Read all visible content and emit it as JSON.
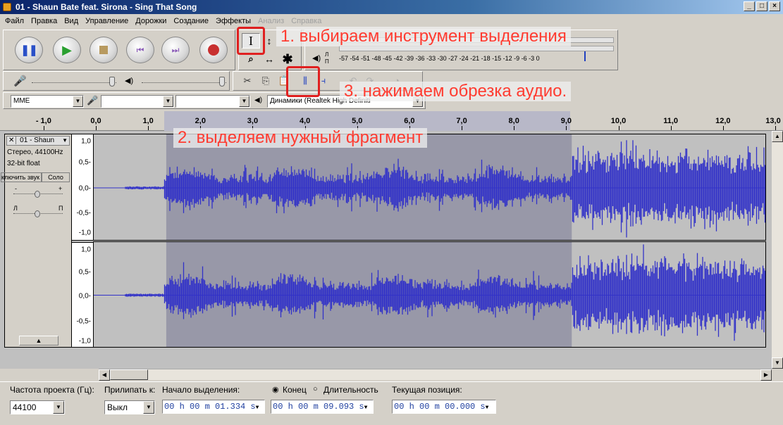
{
  "window": {
    "title": "01 - Shaun Bate feat. Sirona - Sing That Song",
    "controls": [
      "_",
      "□",
      "×"
    ]
  },
  "menu": [
    "Файл",
    "Правка",
    "Вид",
    "Управление",
    "Дорожки",
    "Создание",
    "Эффекты",
    "Анализ",
    "Справка"
  ],
  "transport": {
    "icons": [
      "pause-icon",
      "play-icon",
      "stop-icon",
      "skip-start-icon",
      "skip-end-icon",
      "record-icon"
    ]
  },
  "tools": {
    "selection_tool": "I",
    "envelope_tool": "↕",
    "zoom_tool": "🔍",
    "timeshift_tool": "↔",
    "multi_tool": "✱",
    "active": "selection_tool"
  },
  "meter": {
    "scale": "-57 -54 -51 -48 -45 -42 -39 -36 -33 -30 -27 -24 -21 -18 -15 -12 -9 -6 -3 0",
    "labels": [
      "Л",
      "П"
    ]
  },
  "device": {
    "host": "MME",
    "input": "",
    "channels": "",
    "output": "Динамики (Realtek High Definiti"
  },
  "ruler": {
    "labels": [
      "- 1,0",
      "0,0",
      "1,0",
      "2,0",
      "3,0",
      "4,0",
      "5,0",
      "6,0",
      "7,0",
      "8,0",
      "9,0",
      "10,0",
      "11,0",
      "12,0",
      "13,0"
    ],
    "selection_start": 1.334,
    "selection_end": 9.093
  },
  "track": {
    "name": "01 - Shaun",
    "format": "Стерео, 44100Hz",
    "bit": "32-bit float",
    "mute_label": "ключить звук",
    "solo_label": "Соло",
    "gain_min": "-",
    "gain_max": "+",
    "pan_left": "Л",
    "pan_right": "П",
    "scale_top": [
      "1,0",
      "0,5-",
      "0,0-",
      "-0,5-",
      "-1,0"
    ],
    "scale_bottom": [
      "1,0",
      "0,5-",
      "0,0-",
      "-0,5-",
      "-1,0"
    ]
  },
  "selection_bar": {
    "rate_label": "Частота проекта (Гц):",
    "rate_value": "44100",
    "snap_label": "Прилипать к:",
    "snap_value": "Выкл",
    "start_label": "Начало выделения:",
    "end_label": "Конец",
    "length_label": "Длительность",
    "end_mode_selected": "Конец",
    "position_label": "Текущая позиция:",
    "start_value": "00 h 00 m 01.334 s",
    "end_value": "00 h 00 m 09.093 s",
    "position_value": "00 h 00 m 00.000 s"
  },
  "annotations": {
    "step1": "1. выбираем инструмент выделения",
    "step2": "2. выделяем нужный фрагмент",
    "step3": "3. нажимаем обрезка аудио."
  },
  "colors": {
    "waveform": "#3232c8",
    "selected_bg": "#9898a8",
    "unselected_bg": "#c0c0c0",
    "annotation": "#ff3b30"
  }
}
